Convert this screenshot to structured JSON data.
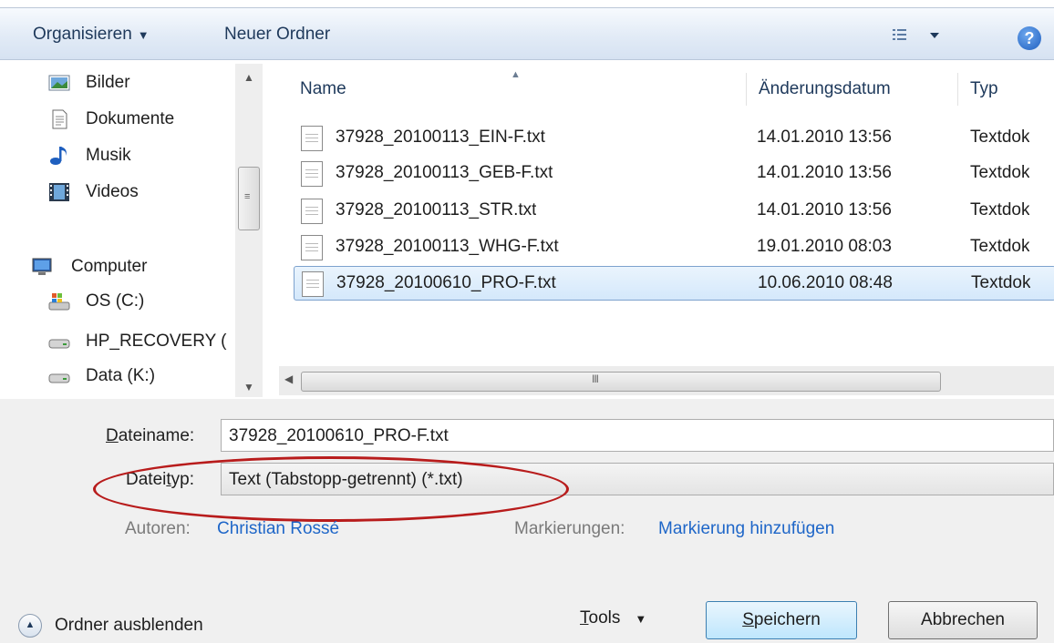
{
  "toolbar": {
    "organize": "Organisieren",
    "new_folder": "Neuer Ordner"
  },
  "nav": {
    "items": [
      {
        "label": "Bilder",
        "icon": "pictures-icon"
      },
      {
        "label": "Dokumente",
        "icon": "documents-icon"
      },
      {
        "label": "Musik",
        "icon": "music-icon"
      },
      {
        "label": "Videos",
        "icon": "videos-icon"
      },
      {
        "label": "Computer",
        "icon": "computer-icon"
      },
      {
        "label": "OS (C:)",
        "icon": "system-drive-icon"
      },
      {
        "label": "HP_RECOVERY (",
        "icon": "drive-icon"
      },
      {
        "label": "Data (K:)",
        "icon": "drive-icon"
      }
    ]
  },
  "list": {
    "columns": {
      "name": "Name",
      "date": "Änderungsdatum",
      "type": "Typ"
    },
    "rows": [
      {
        "name": "37928_20100113_EIN-F.txt",
        "date": "14.01.2010 13:56",
        "type": "Textdok"
      },
      {
        "name": "37928_20100113_GEB-F.txt",
        "date": "14.01.2010 13:56",
        "type": "Textdok"
      },
      {
        "name": "37928_20100113_STR.txt",
        "date": "14.01.2010 13:56",
        "type": "Textdok"
      },
      {
        "name": "37928_20100113_WHG-F.txt",
        "date": "19.01.2010 08:03",
        "type": "Textdok"
      },
      {
        "name": "37928_20100610_PRO-F.txt",
        "date": "10.06.2010 08:48",
        "type": "Textdok"
      }
    ]
  },
  "form": {
    "filename_label_u": "D",
    "filename_label_rest": "ateiname:",
    "filename_value": "37928_20100610_PRO-F.txt",
    "filetype_label_a": "Datei",
    "filetype_label_u": "t",
    "filetype_label_b": "yp:",
    "filetype_value": "Text (Tabstopp-getrennt) (*.txt)",
    "authors_label": "Autoren:",
    "authors_value": "Christian Rossé",
    "tags_label": "Markierungen:",
    "tags_value": "Markierung hinzufügen"
  },
  "footer": {
    "hide_folders": "Ordner ausblenden",
    "tools_u": "T",
    "tools_rest": "ools",
    "save_u": "S",
    "save_rest": "peichern",
    "cancel": "Abbrechen"
  },
  "colors": {
    "highlight_ring": "#b81c1c",
    "link": "#1e66c8",
    "selection": "#d4e8fb"
  }
}
